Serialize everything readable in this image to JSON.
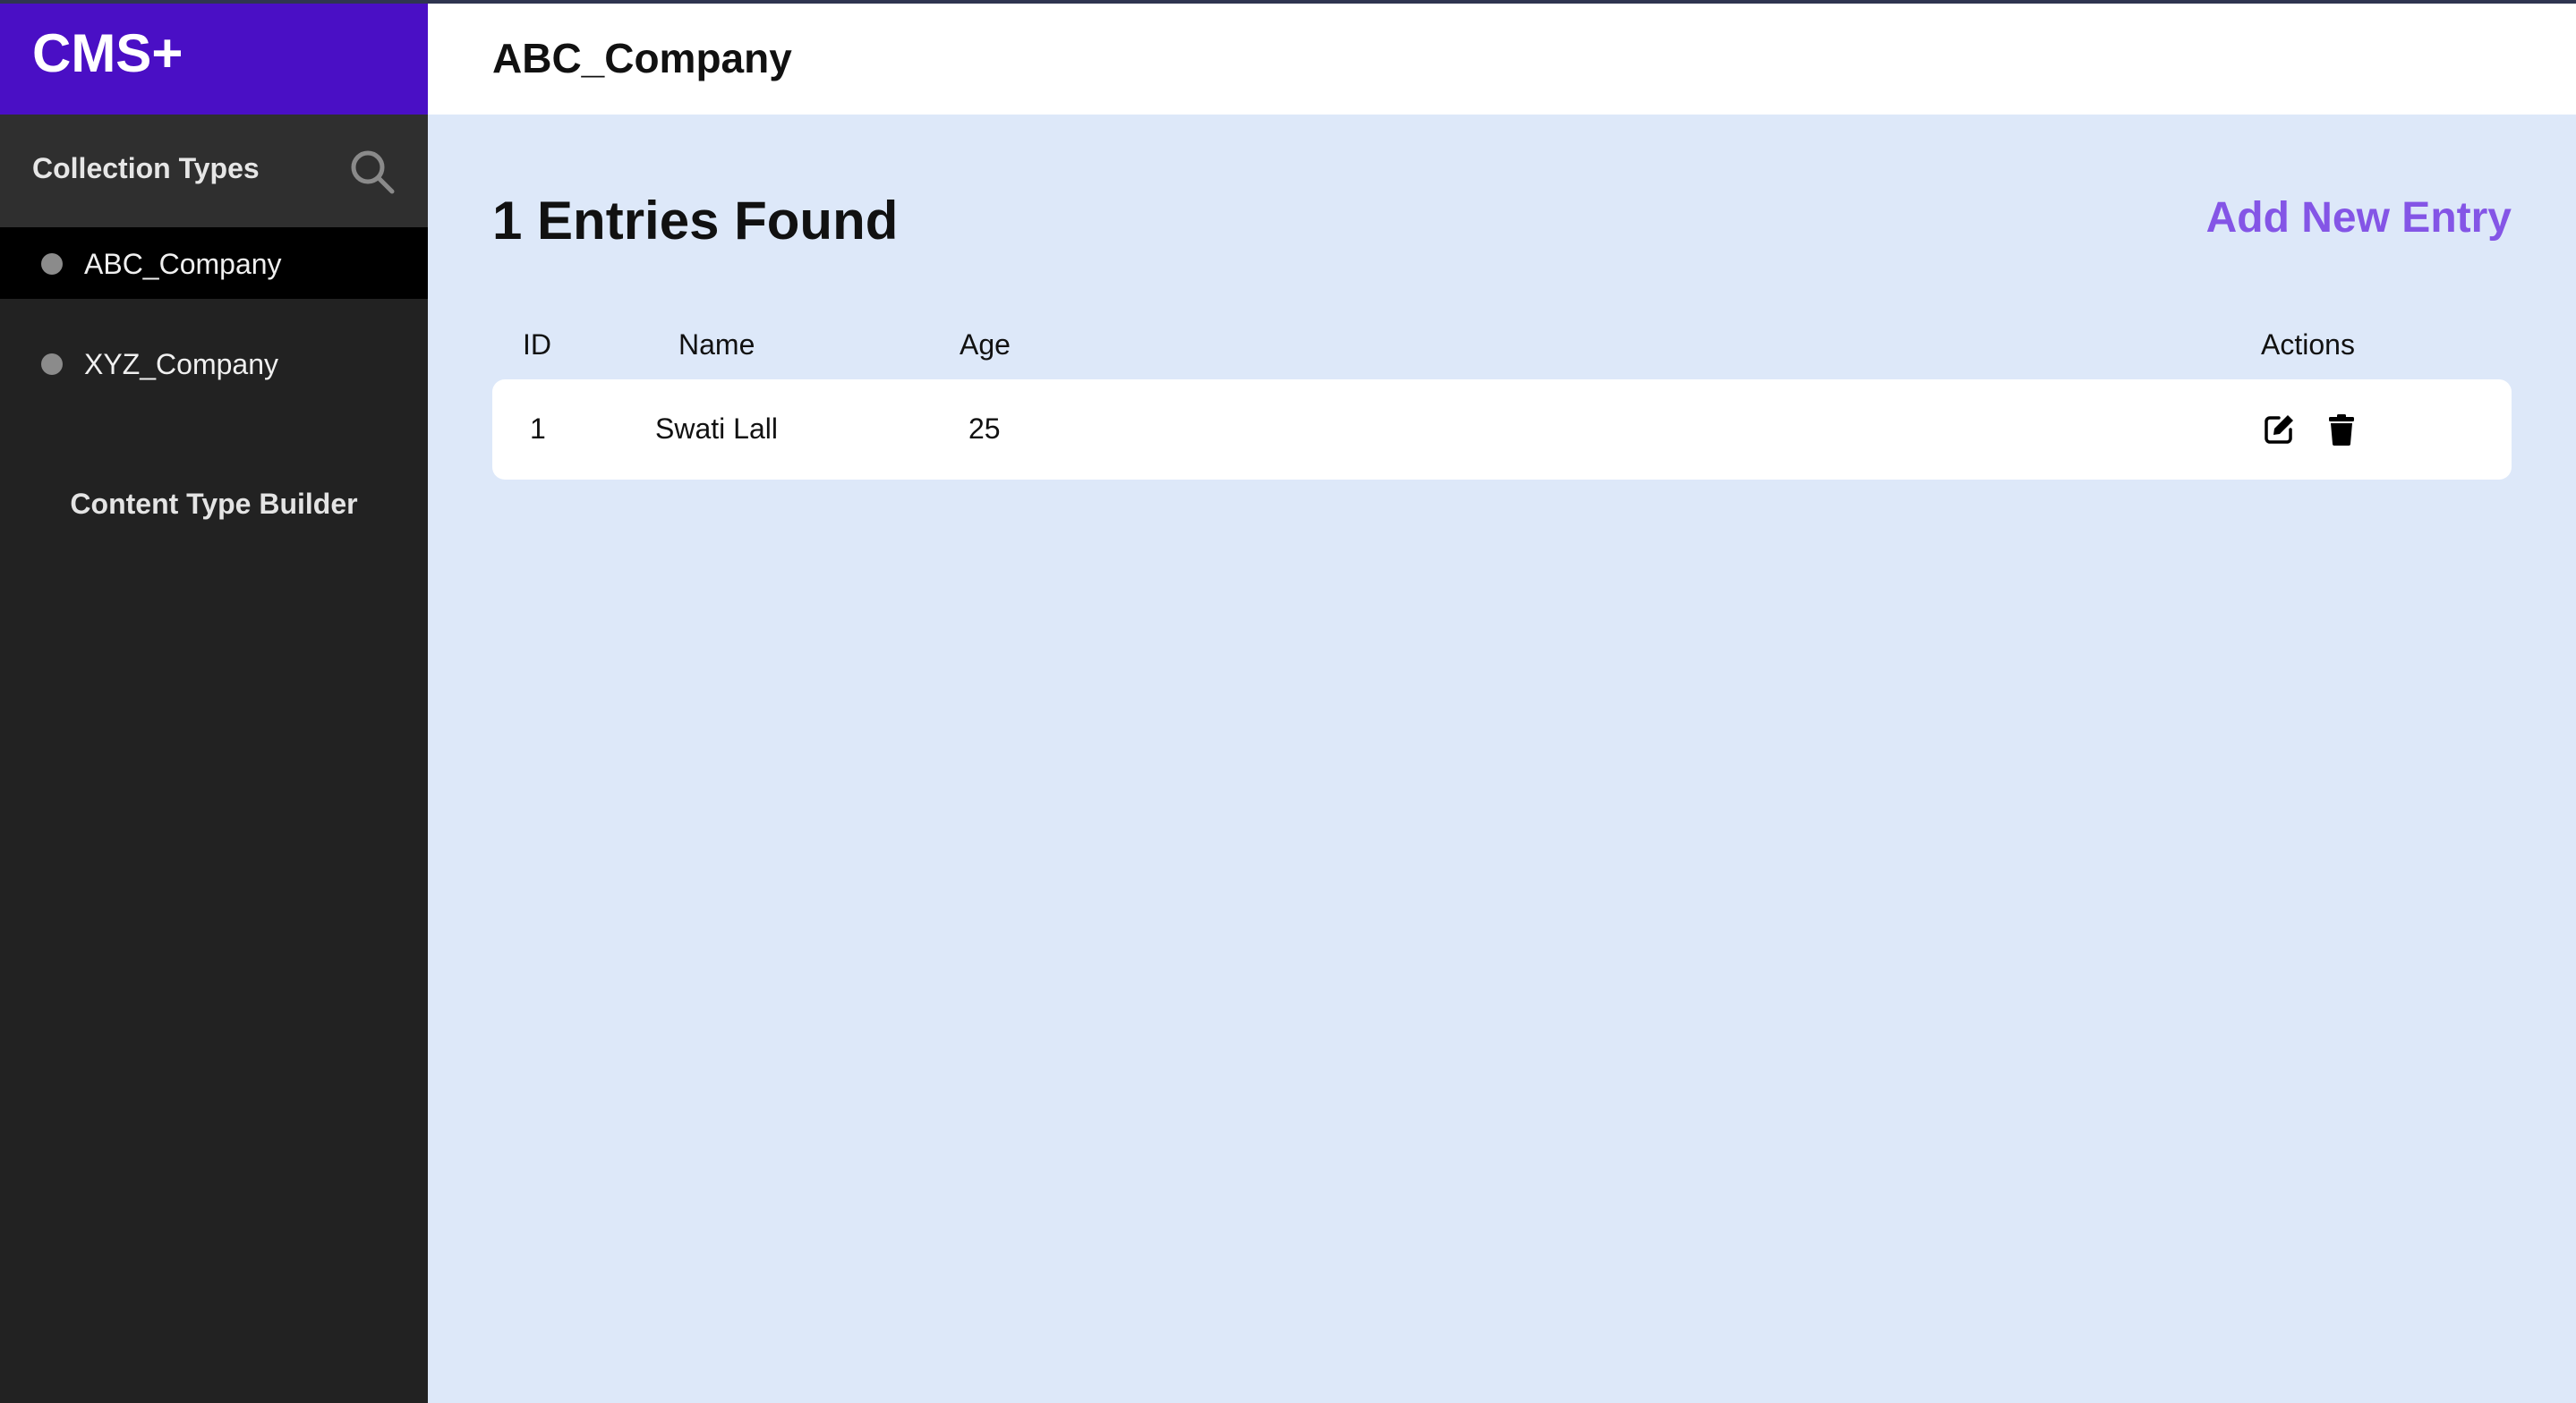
{
  "brand": {
    "name": "CMS+"
  },
  "sidebar": {
    "section_title": "Collection Types",
    "search_icon": "search-icon",
    "items": [
      {
        "label": "ABC_Company",
        "active": true
      },
      {
        "label": "XYZ_Company",
        "active": false
      }
    ],
    "builder_label": "Content Type Builder"
  },
  "header": {
    "title": "ABC_Company"
  },
  "main": {
    "entries_heading": "1 Entries Found",
    "add_button_label": "Add New Entry",
    "table": {
      "columns": [
        "ID",
        "Name",
        "Age",
        "Actions"
      ],
      "rows": [
        {
          "id": "1",
          "name": "Swati Lall",
          "age": "25",
          "actions": [
            "edit-icon",
            "trash-icon"
          ]
        }
      ]
    }
  },
  "colors": {
    "brand_bg": "#4a0fc5",
    "sidebar_bg": "#222222",
    "active_item_bg": "#000000",
    "main_bg": "#dde8f9",
    "accent_link": "#8455e6"
  }
}
